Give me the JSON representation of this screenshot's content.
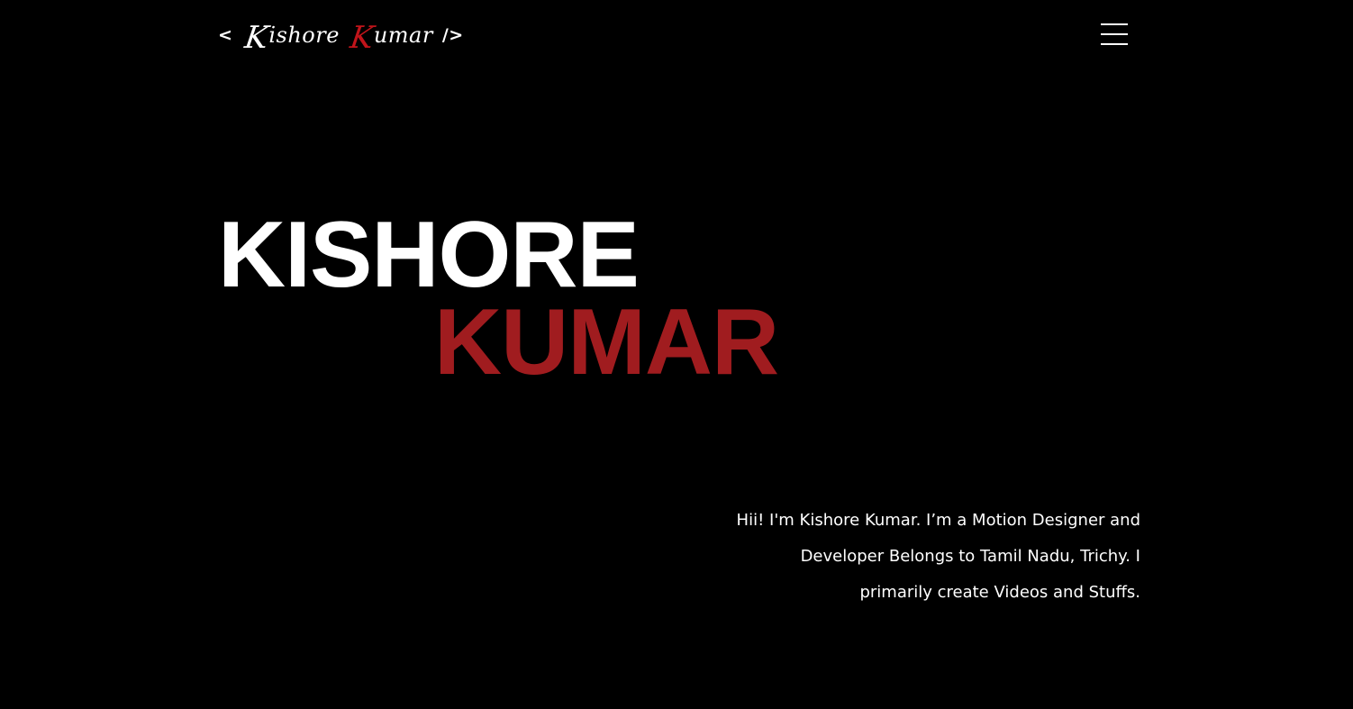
{
  "header": {
    "logo": {
      "bracket_open": "<",
      "first_initial": "K",
      "first_rest": "ishore",
      "last_initial": "K",
      "last_rest": "umar",
      "bracket_close": "/>",
      "accent_color": "#c0141a"
    },
    "menu_icon": "hamburger-menu-icon"
  },
  "hero": {
    "first_name": "KISHORE",
    "last_name": "KUMAR",
    "first_color": "#ffffff",
    "last_color": "#a01c1f"
  },
  "intro": {
    "lines": [
      "Hii! I'm Kishore Kumar. I’m a Motion Designer and",
      "Developer Belongs to Tamil Nadu, Trichy. I",
      "primarily create Videos and Stuffs."
    ]
  },
  "colors": {
    "background": "#000000",
    "text": "#ffffff",
    "accent": "#a01c1f"
  }
}
